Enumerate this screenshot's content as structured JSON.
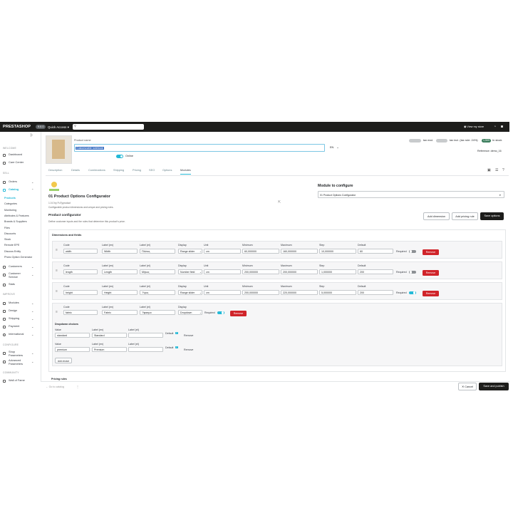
{
  "topbar": {
    "brand": "PRESTASHOP",
    "version": "9.0.0",
    "quick_access": "Quick Access",
    "search_placeholder": "Search (e.g.: product reference, customer name...)",
    "view_store": "View my store"
  },
  "sidebar": {
    "welcome": "WELCOME",
    "dashboard": "Dashboard",
    "care_center": "Care Center",
    "sell": "SELL",
    "orders": "Orders",
    "catalog": "Catalog",
    "catalog_sub": [
      "Products",
      "Categories",
      "Monitoring",
      "Attributes & Features",
      "Brands & Suppliers",
      "Files",
      "Discounts",
      "Stock",
      "Remote EPE",
      "Discuss Entity",
      "Photo Option Generator"
    ],
    "customers": "Customers",
    "customer_service": "Customer Service",
    "stats": "Stats",
    "improve": "IMPROVE",
    "modules": "Modules",
    "design": "Design",
    "shipping": "Shipping",
    "payment": "Payment",
    "international": "International",
    "configure": "CONFIGURE",
    "shop_parameters": "Shop Parameters",
    "advanced_parameters": "Advanced Parameters",
    "community": "COMMUNITY",
    "wall_of_fame": "Wall of Fame"
  },
  "product": {
    "name_label": "Product name",
    "name_value": "Customizable notebook",
    "lang": "EN",
    "online": "Online",
    "tax_excl_label": "tax excl.",
    "tax_incl_label": "tax incl. (tax rule: 24%)",
    "in_stock": "In stock",
    "in_stock_count": "1,509",
    "reference": "Reference: demo_16"
  },
  "tabs": [
    "Description",
    "Details",
    "Combinations",
    "Shipping",
    "Pricing",
    "SEO",
    "Options",
    "Modules"
  ],
  "module": {
    "name": "01 Product Options Configurator",
    "version": "1.0.0 by FuTyproduct",
    "desc": "Configurable product dimensions and unique and pricing rules.",
    "configure_label": "Module to configure",
    "configure_value": "01 Product Options Configurator",
    "section_title": "Product configurator",
    "section_desc": "Define customer inputs and the rules that determine this product's price.",
    "add_dimension": "Add dimension",
    "add_pricing_rule": "Add pricing rule",
    "save_options": "Save options"
  },
  "dims": {
    "title": "Dimensions and fields",
    "headers": [
      "Code",
      "Label (en)",
      "Label (el)",
      "Display",
      "Unit",
      "Minimum",
      "Maximum",
      "Step",
      "Default"
    ],
    "required": "Required",
    "remove": "Remove",
    "rows": [
      {
        "code": "width",
        "label_en": "Width",
        "label_el": "Πλάτος",
        "display": "Range slider",
        "unit": "cm",
        "min": "60,000000",
        "max": "160,000000",
        "step": "10,000000",
        "default": "60"
      },
      {
        "code": "length",
        "label_en": "Length",
        "label_el": "Μήκος",
        "display": "Number field",
        "unit": "cm",
        "min": "200,000000",
        "max": "200,000000",
        "step": "1,000000",
        "default": "200"
      },
      {
        "code": "height",
        "label_en": "Height",
        "label_el": "Ύψος",
        "display": "Range slider",
        "unit": "cm",
        "min": "200,000000",
        "max": "220,000000",
        "step": "5,000000",
        "default": "200"
      }
    ],
    "fabric": {
      "code": "fabric",
      "label_en": "Fabric",
      "label_el": "Ύφασμα",
      "display": "Dropdown"
    },
    "dropdown_title": "Dropdown choices",
    "choice_headers": [
      "Value",
      "Label (en)",
      "Label (el)"
    ],
    "choices": [
      {
        "value": "standard",
        "label_en": "Standard",
        "label_el": ""
      },
      {
        "value": "premium",
        "label_en": "Premium",
        "label_el": ""
      }
    ],
    "default_label": "Default",
    "add_choice": "Add choice",
    "pricing_rules": "Pricing rules"
  },
  "footer": {
    "go_to_catalog": "Go to catalog",
    "cancel": "Cancel",
    "save_publish": "Save and publish"
  },
  "colors": {
    "accent": "#24b9d7",
    "danger": "#d0242a",
    "dark": "#1d1d1b"
  }
}
